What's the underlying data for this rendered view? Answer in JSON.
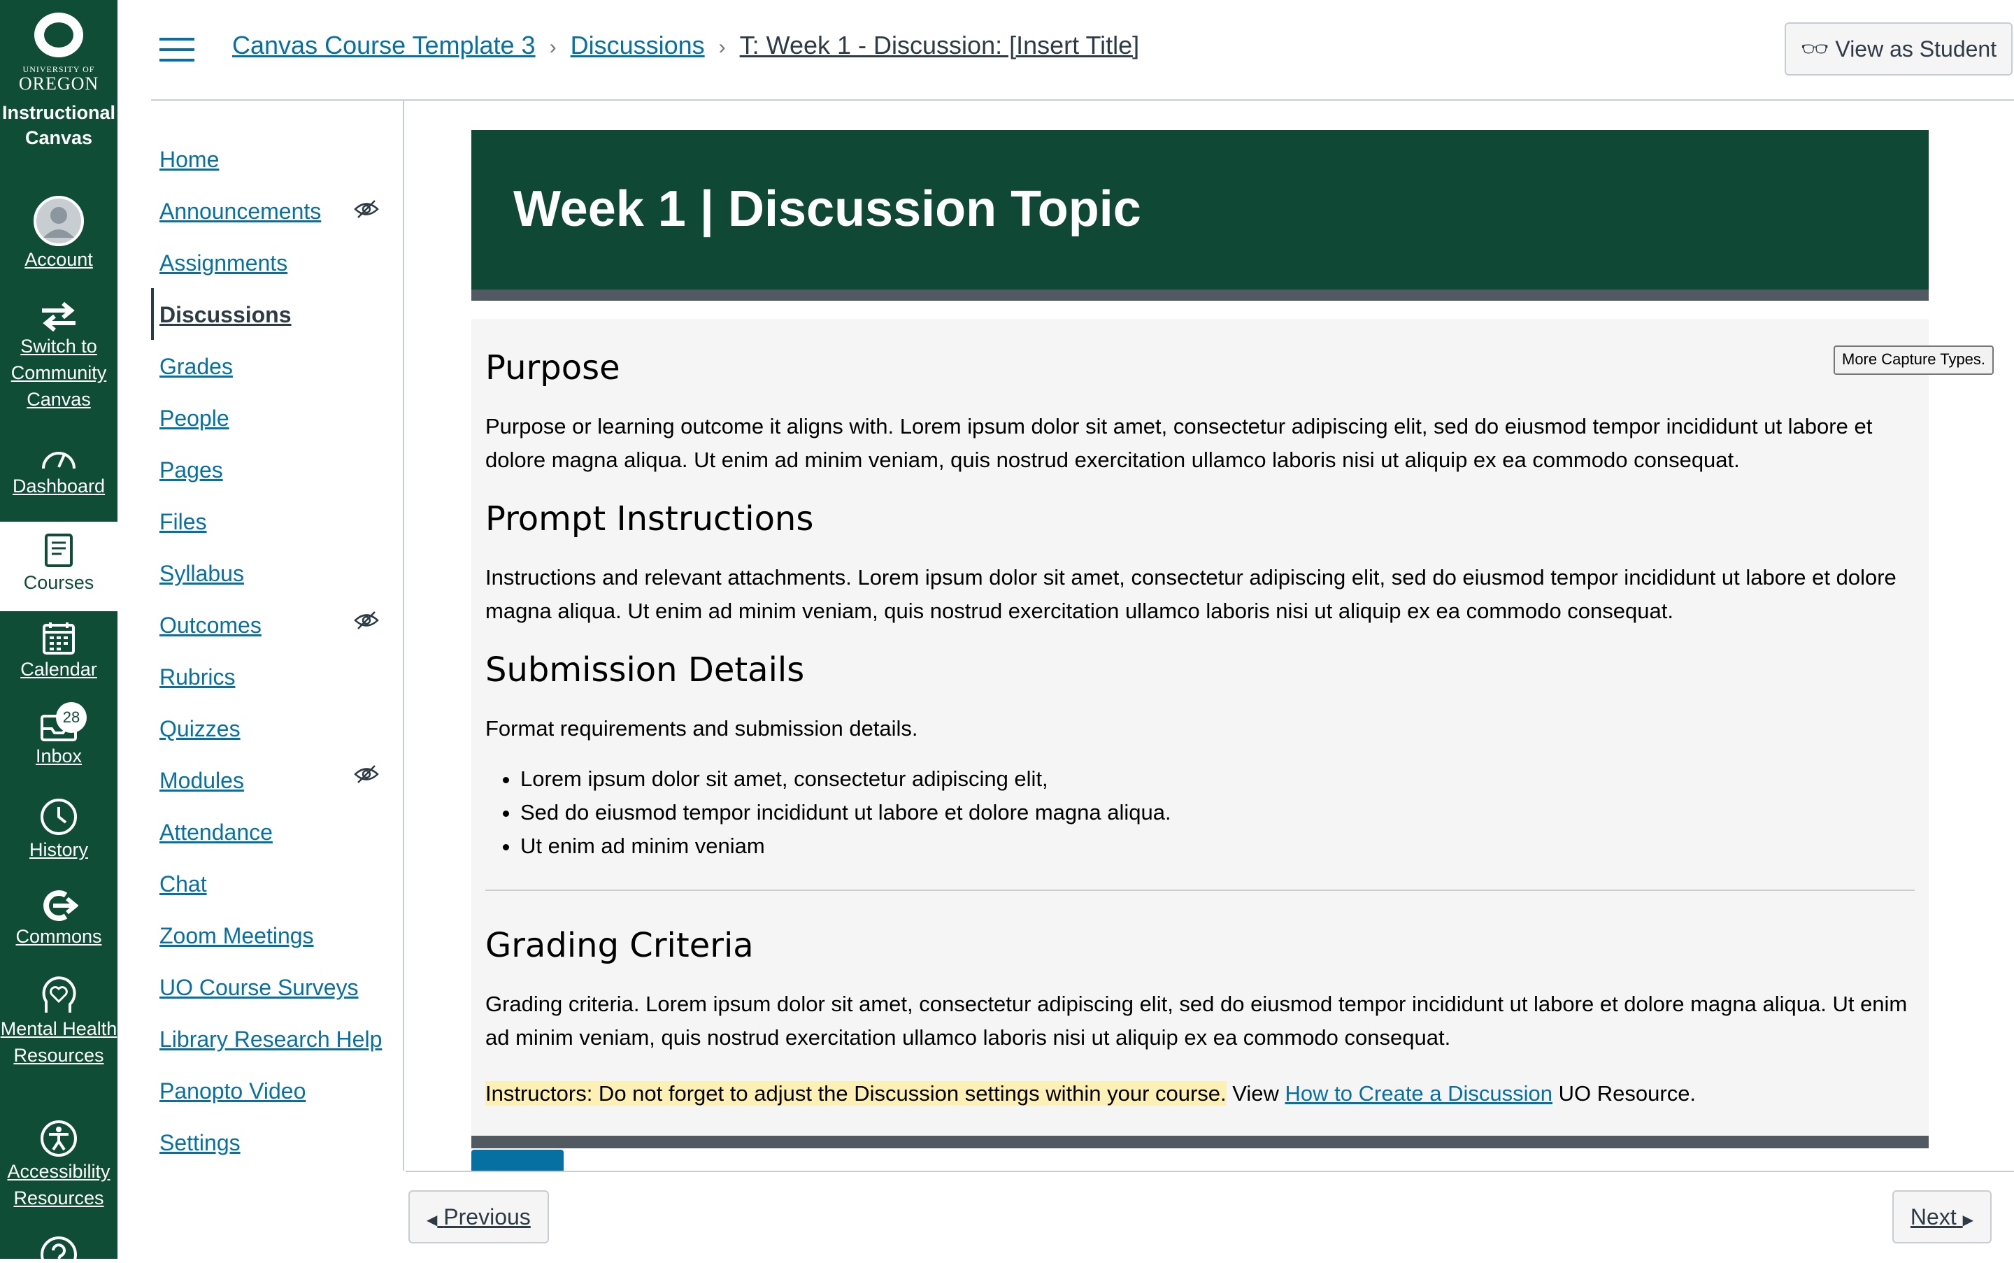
{
  "global_nav": {
    "logo": {
      "university": "UNIVERSITY OF",
      "name": "OREGON",
      "app_name": "Instructional Canvas"
    },
    "items": [
      {
        "label": "Account",
        "icon": "avatar-icon"
      },
      {
        "label": "Switch to Community Canvas",
        "icon": "switch-arrows-icon"
      },
      {
        "label": "Dashboard",
        "icon": "dashboard-gauge-icon"
      },
      {
        "label": "Courses",
        "icon": "book-icon",
        "active": true
      },
      {
        "label": "Calendar",
        "icon": "calendar-icon"
      },
      {
        "label": "Inbox",
        "icon": "inbox-icon",
        "badge": "28"
      },
      {
        "label": "History",
        "icon": "clock-icon"
      },
      {
        "label": "Commons",
        "icon": "commons-arrow-icon"
      },
      {
        "label": "Mental Health Resources",
        "icon": "heart-head-icon"
      },
      {
        "label": "Accessibility Resources",
        "icon": "accessibility-icon"
      }
    ]
  },
  "header": {
    "breadcrumbs": [
      "Canvas Course Template 3",
      "Discussions",
      "T: Week 1 - Discussion: [Insert Title]"
    ],
    "view_as_student": "View as Student"
  },
  "course_nav": [
    {
      "label": "Home"
    },
    {
      "label": "Announcements",
      "hidden": true
    },
    {
      "label": "Assignments"
    },
    {
      "label": "Discussions",
      "active": true
    },
    {
      "label": "Grades"
    },
    {
      "label": "People"
    },
    {
      "label": "Pages"
    },
    {
      "label": "Files"
    },
    {
      "label": "Syllabus"
    },
    {
      "label": "Outcomes",
      "hidden": true
    },
    {
      "label": "Rubrics"
    },
    {
      "label": "Quizzes"
    },
    {
      "label": "Modules",
      "hidden": true
    },
    {
      "label": "Attendance"
    },
    {
      "label": "Chat"
    },
    {
      "label": "Zoom Meetings"
    },
    {
      "label": "UO Course Surveys"
    },
    {
      "label": "Library Research Help"
    },
    {
      "label": "Panopto Video"
    },
    {
      "label": "Settings"
    }
  ],
  "content": {
    "banner_title": "Week 1 | Discussion Topic",
    "purpose": {
      "heading": "Purpose",
      "text": "Purpose or learning outcome it aligns with. Lorem ipsum dolor sit amet, consectetur adipiscing elit, sed do eiusmod tempor incididunt ut labore et dolore magna aliqua. Ut enim ad minim veniam, quis nostrud exercitation ullamco laboris nisi ut aliquip ex ea commodo consequat."
    },
    "prompt": {
      "heading": "Prompt Instructions",
      "text": "Instructions and relevant attachments. Lorem ipsum dolor sit amet, consectetur adipiscing elit, sed do eiusmod tempor incididunt ut labore et dolore magna aliqua. Ut enim ad minim veniam, quis nostrud exercitation ullamco laboris nisi ut aliquip ex ea commodo consequat."
    },
    "submission": {
      "heading": "Submission Details",
      "text": "Format requirements and submission details.",
      "bullets": [
        "Lorem ipsum dolor sit amet, consectetur adipiscing elit,",
        "Sed do eiusmod tempor incididunt ut labore et dolore magna aliqua.",
        "Ut enim ad minim veniam"
      ]
    },
    "grading": {
      "heading": "Grading Criteria",
      "text": "Grading criteria. Lorem ipsum dolor sit amet, consectetur adipiscing elit, sed do eiusmod tempor incididunt ut labore et dolore magna aliqua. Ut enim ad minim veniam, quis nostrud exercitation ullamco laboris nisi ut aliquip ex ea commodo consequat."
    },
    "note_highlight": "Instructors: Do not forget to adjust the Discussion settings within your course.",
    "note_view": " View ",
    "note_link": "How to Create a Discussion",
    "note_tail": " UO Resource."
  },
  "tooltip": "More Capture Types.",
  "footer": {
    "previous": "Previous",
    "next": "Next"
  },
  "colors": {
    "brand_green": "#0f4d36",
    "link_blue": "#0770a3",
    "highlight": "#fdf0b5"
  }
}
